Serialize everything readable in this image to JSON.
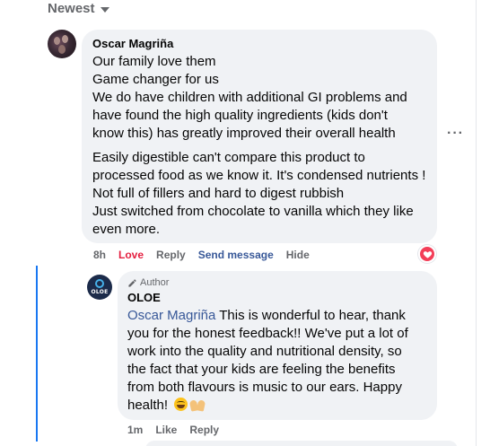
{
  "sort": {
    "label": "Newest"
  },
  "comment": {
    "author": "Oscar Magriña",
    "paragraphs": [
      [
        "Our family love them",
        "Game changer for us",
        "We do have children with additional GI problems and",
        "have found the high quality ingredients (kids don't",
        "know this) has greatly improved their overall health"
      ],
      [
        "Easily digestible can't compare this product to",
        "processed food as we know it. It's condensed nutrients !",
        "Not full of fillers and hard to digest rubbish",
        "Just switched from chocolate to vanilla which they like",
        "even more."
      ]
    ],
    "more_icon": "more-horizontal-icon",
    "actions": {
      "time": "8h",
      "love": "Love",
      "reply": "Reply",
      "send_message": "Send message",
      "hide": "Hide"
    },
    "reaction": {
      "icon": "heart-icon",
      "color": "#f33e58"
    }
  },
  "reply": {
    "badge": "Author",
    "badge_icon": "pencil-icon",
    "author": "OLOE",
    "avatar_text": "OLOE",
    "mention": "Oscar Magriña",
    "lines": [
      " This is wonderful to hear, thank",
      "you for the honest feedback!! We've put a lot of",
      "work into the quality and nutritional density, so",
      "the fact that your kids are feeling the benefits",
      "from both flavours is music to our ears. Happy",
      "health! "
    ],
    "emojis": [
      "smiling-face-emoji",
      "raising-hands-emoji"
    ],
    "actions": {
      "time": "1m",
      "like": "Like",
      "reply": "Reply"
    }
  },
  "colors": {
    "bubble": "#f0f2f5",
    "muted_text": "#65676b",
    "link": "#385898",
    "love": "#e41e3f",
    "thread_line": "#1877f2"
  }
}
